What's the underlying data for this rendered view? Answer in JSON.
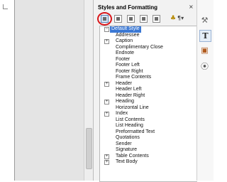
{
  "panel": {
    "title": "Styles and Formatting",
    "close_symbol": "×"
  },
  "toolbar": {
    "paint_icon_glyph": "♣",
    "menu_glyph": "¶▾"
  },
  "styles": {
    "root_label": "Default Style",
    "items": [
      {
        "label": "Addressee",
        "expandable": false
      },
      {
        "label": "Caption",
        "expandable": true
      },
      {
        "label": "Complimentary Close",
        "expandable": false
      },
      {
        "label": "Endnote",
        "expandable": false
      },
      {
        "label": "Footer",
        "expandable": false
      },
      {
        "label": "Footer Left",
        "expandable": false
      },
      {
        "label": "Footer Right",
        "expandable": false
      },
      {
        "label": "Frame Contents",
        "expandable": false
      },
      {
        "label": "Header",
        "expandable": true
      },
      {
        "label": "Header Left",
        "expandable": false
      },
      {
        "label": "Header Right",
        "expandable": false
      },
      {
        "label": "Heading",
        "expandable": true
      },
      {
        "label": "Horizontal Line",
        "expandable": false
      },
      {
        "label": "Index",
        "expandable": true
      },
      {
        "label": "List Contents",
        "expandable": false
      },
      {
        "label": "List Heading",
        "expandable": false
      },
      {
        "label": "Preformatted Text",
        "expandable": false
      },
      {
        "label": "Quotations",
        "expandable": false
      },
      {
        "label": "Sender",
        "expandable": false
      },
      {
        "label": "Signature",
        "expandable": false
      },
      {
        "label": "Table Contents",
        "expandable": true
      },
      {
        "label": "Text Body",
        "expandable": true
      }
    ]
  },
  "sidebar": {
    "styles_glyph": "T",
    "wrench_glyph": "⚒",
    "gallery_glyph": "▣",
    "navigator_glyph": "⦿"
  },
  "colors": {
    "highlight": "#d8161a",
    "selection": "#3b78d4"
  }
}
